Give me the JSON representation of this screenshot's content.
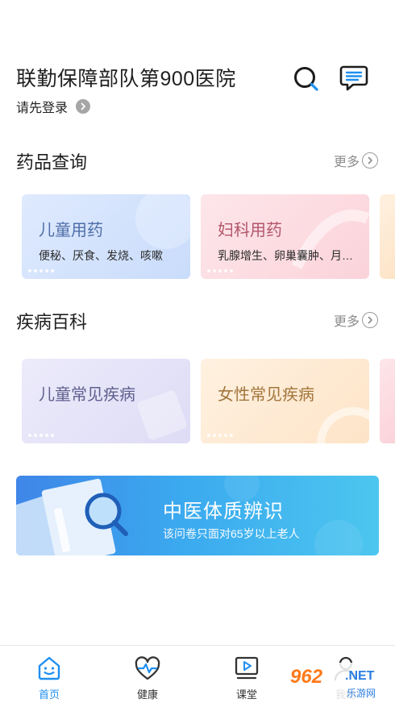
{
  "header": {
    "hospital_name": "联勤保障部队第900医院",
    "login_text": "请先登录"
  },
  "drug_section": {
    "title": "药品查询",
    "more_label": "更多",
    "cards": [
      {
        "title": "儿童用药",
        "subtitle": "便秘、厌食、发烧、咳嗽"
      },
      {
        "title": "妇科用药",
        "subtitle": "乳腺增生、卵巢囊肿、月经不调"
      }
    ]
  },
  "disease_section": {
    "title": "疾病百科",
    "more_label": "更多",
    "cards": [
      {
        "title": "儿童常见疾病"
      },
      {
        "title": "女性常见疾病"
      }
    ]
  },
  "banner": {
    "title": "中医体质辨识",
    "subtitle": "该问卷只面对65岁以上老人"
  },
  "tabbar": {
    "active_color": "#1f8ff0",
    "items": [
      {
        "label": "首页",
        "icon": "home-smile-icon"
      },
      {
        "label": "健康",
        "icon": "heart-pulse-icon"
      },
      {
        "label": "课堂",
        "icon": "video-play-icon"
      },
      {
        "label": "我的",
        "icon": "user-icon"
      }
    ]
  },
  "watermark": {
    "number": "962",
    "domain": ".NET",
    "text": "乐游网"
  }
}
